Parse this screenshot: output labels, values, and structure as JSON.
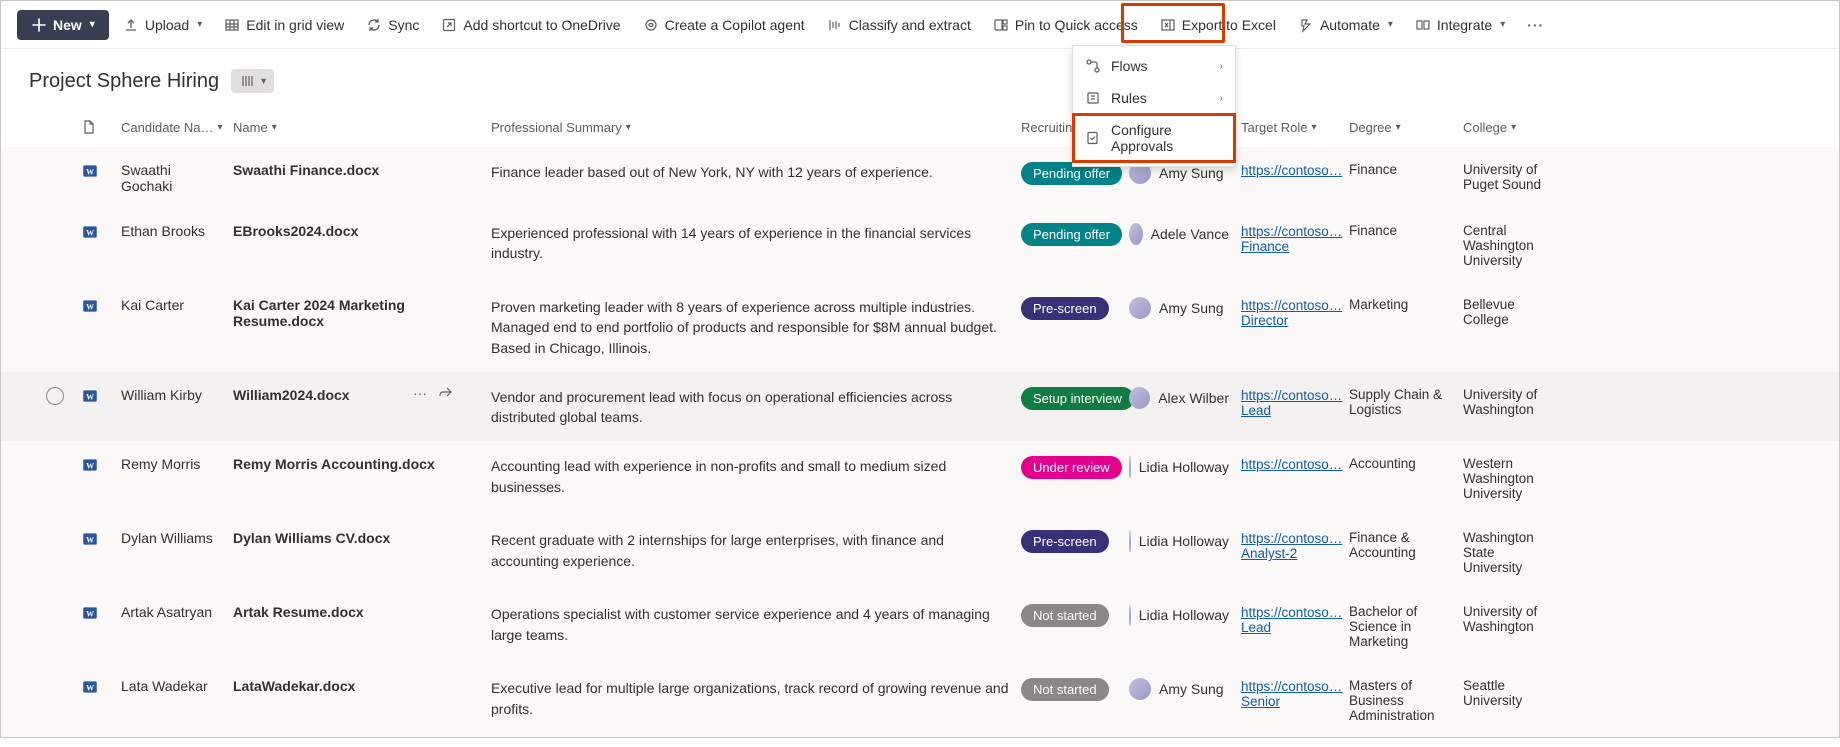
{
  "toolbar": {
    "new_label": "New",
    "upload_label": "Upload",
    "edit_grid_label": "Edit in grid view",
    "sync_label": "Sync",
    "shortcut_label": "Add shortcut to OneDrive",
    "copilot_label": "Create a Copilot agent",
    "classify_label": "Classify and extract",
    "pin_label": "Pin to Quick access",
    "export_label": "Export to Excel",
    "automate_label": "Automate",
    "integrate_label": "Integrate"
  },
  "automate_menu": {
    "flows": "Flows",
    "rules": "Rules",
    "configure": "Configure Approvals"
  },
  "page": {
    "title": "Project Sphere Hiring"
  },
  "columns": {
    "candidate": "Candidate Na…",
    "name": "Name",
    "summary": "Professional Summary",
    "status": "Recruiting S",
    "person_partial": "",
    "target_role": "Target Role",
    "degree": "Degree",
    "college": "College"
  },
  "rows": [
    {
      "candidate": "Swaathi Gochaki",
      "docname": "Swaathi Finance.docx",
      "summary": "Finance leader based out of New York, NY with 12 years of experience.",
      "status": "Pending offer",
      "status_class": "st-teal",
      "person": "Amy Sung",
      "link1": "https://contoso…",
      "link2": "",
      "degree": "Finance",
      "college": "University of Puget Sound"
    },
    {
      "candidate": "Ethan Brooks",
      "docname": "EBrooks2024.docx",
      "summary": "Experienced professional with 14 years of experience in the financial services industry.",
      "status": "Pending offer",
      "status_class": "st-teal",
      "person": "Adele Vance",
      "link1": "https://contoso…",
      "link2": "Finance",
      "degree": "Finance",
      "college": "Central Washington University"
    },
    {
      "candidate": "Kai Carter",
      "docname": "Kai Carter 2024 Marketing Resume.docx",
      "summary": "Proven marketing leader with 8 years of experience across multiple industries. Managed end to end portfolio of products and responsible for $8M annual budget. Based in Chicago, Illinois.",
      "status": "Pre-screen",
      "status_class": "st-indigo",
      "person": "Amy Sung",
      "link1": "https://contoso…",
      "link2": "Director",
      "degree": "Marketing",
      "college": "Bellevue College"
    },
    {
      "candidate": "William Kirby",
      "docname": "William2024.docx",
      "summary": "Vendor and procurement lead with focus on operational efficiencies across distributed global teams.",
      "status": "Setup interview",
      "status_class": "st-green",
      "person": "Alex Wilber",
      "link1": "https://contoso…",
      "link2": "Lead",
      "degree": "Supply Chain & Logistics",
      "college": "University of Washington",
      "hover": true
    },
    {
      "candidate": "Remy Morris",
      "docname": "Remy Morris Accounting.docx",
      "summary": "Accounting lead with experience in non-profits and small to medium sized businesses.",
      "status": "Under review",
      "status_class": "st-pink",
      "person": "Lidia Holloway",
      "link1": "https://contoso…",
      "link2": "",
      "degree": "Accounting",
      "college": "Western Washington University"
    },
    {
      "candidate": "Dylan Williams",
      "docname": "Dylan Williams CV.docx",
      "summary": "Recent graduate with 2 internships for large enterprises, with finance and accounting experience.",
      "status": "Pre-screen",
      "status_class": "st-indigo",
      "person": "Lidia Holloway",
      "link1": "https://contoso…",
      "link2": "Analyst-2",
      "degree": "Finance & Accounting",
      "college": "Washington State University"
    },
    {
      "candidate": "Artak Asatryan",
      "docname": "Artak Resume.docx",
      "summary": "Operations specialist with customer service experience and 4 years of managing large teams.",
      "status": "Not started",
      "status_class": "st-gray",
      "person": "Lidia Holloway",
      "link1": "https://contoso…",
      "link2": "Lead",
      "degree": "Bachelor of Science in Marketing",
      "college": "University of Washington"
    },
    {
      "candidate": "Lata Wadekar",
      "docname": "LataWadekar.docx",
      "summary": "Executive lead for multiple large organizations, track record of growing revenue and profits.",
      "status": "Not started",
      "status_class": "st-gray",
      "person": "Amy Sung",
      "link1": "https://contoso…",
      "link2": "Senior",
      "degree": "Masters of Business Administration",
      "college": "Seattle University"
    }
  ]
}
